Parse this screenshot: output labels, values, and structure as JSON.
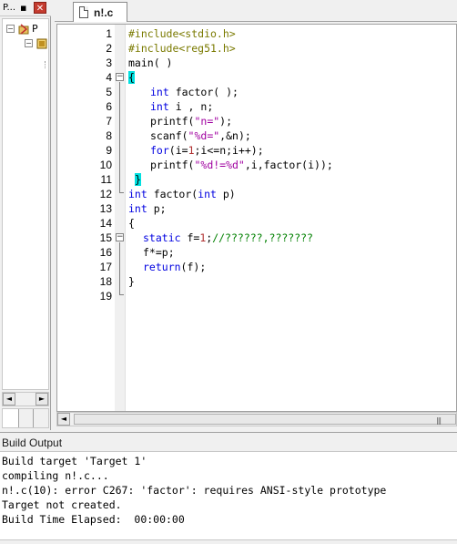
{
  "project_panel": {
    "title": "P...",
    "pin_glyph": "▪",
    "close_glyph": "✕",
    "tree": [
      {
        "label": "P",
        "expander": "−"
      },
      {
        "label": "",
        "expander": "−"
      }
    ]
  },
  "editor": {
    "tab_label": "n!.c",
    "line_numbers": [
      "1",
      "2",
      "3",
      "4",
      "5",
      "6",
      "7",
      "8",
      "9",
      "10",
      "11",
      "12",
      "13",
      "14",
      "15",
      "16",
      "17",
      "18",
      "19"
    ],
    "fold_collapse_glyph": "−"
  },
  "code": {
    "l1": "#include<stdio.h>",
    "l2": "#include<reg51.h>",
    "l3": "main( )",
    "l4": "{",
    "l5_kw": "int",
    "l5_rest": " factor( );",
    "l6_kw": "int",
    "l6_rest": " i , n;",
    "l7_a": "printf(",
    "l7_str": "\"n=\"",
    "l7_b": ");",
    "l8_a": "scanf(",
    "l8_str": "\"%d=\"",
    "l8_b": ",&n);",
    "l9_kw": "for",
    "l9_a": "(i=",
    "l9_n": "1",
    "l9_b": ";i<=n;i++);",
    "l10_a": "printf(",
    "l10_str": "\"%d!=%d\"",
    "l10_b": ",i,factor(i));",
    "l11": "}",
    "l12_kw1": "int",
    "l12_a": " factor(",
    "l12_kw2": "int",
    "l12_b": " p)",
    "l13_kw": "int",
    "l13_rest": " p;",
    "l14": "{",
    "l15_kw": "static",
    "l15_a": " f=",
    "l15_n": "1",
    "l15_b": ";",
    "l15_cm": "//??????,???????",
    "l16": "f*=p;",
    "l17_kw": "return",
    "l17_rest": "(f);",
    "l18": "}"
  },
  "build_output": {
    "title": "Build Output",
    "lines": [
      "Build target 'Target 1'",
      "compiling n!.c...",
      "n!.c(10): error C267: 'factor': requires ANSI-style prototype",
      "Target not created.",
      "Build Time Elapsed:  00:00:00"
    ]
  },
  "scrollbar": {
    "left_arrow": "◄",
    "right_arrow": "►",
    "grip": "|||"
  },
  "colors": {
    "preprocessor": "#7a7a00",
    "keyword": "#0000e0",
    "string": "#a000a0",
    "number": "#b03030",
    "comment": "#008000",
    "brace_highlight": "#00e0e0"
  }
}
